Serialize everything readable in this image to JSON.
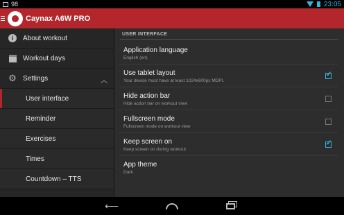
{
  "status_bar": {
    "notification_text": "98",
    "time": "23:05"
  },
  "action_bar": {
    "title": "Caynax A6W PRO"
  },
  "drawer": {
    "items": [
      {
        "label": "About workout",
        "icon": "info-icon"
      },
      {
        "label": "Workout days",
        "icon": "calendar-icon"
      },
      {
        "label": "Settings",
        "icon": "gear-icon",
        "expanded": true
      }
    ],
    "subitems": [
      {
        "label": "User interface",
        "active": true
      },
      {
        "label": "Reminder"
      },
      {
        "label": "Exercises"
      },
      {
        "label": "Times"
      },
      {
        "label": "Countdown – TTS"
      }
    ]
  },
  "content": {
    "section_title": "USER INTERFACE",
    "preferences": [
      {
        "title": "Application language",
        "summary": "English (en)",
        "checkbox": null
      },
      {
        "title": "Use tablet layout",
        "summary": "Your device must have at least 1024x600px MDPI.",
        "checkbox": true
      },
      {
        "title": "Hide action bar",
        "summary": "Hide action bar on workout view",
        "checkbox": false
      },
      {
        "title": "Fullscreen mode",
        "summary": "Fullscreen mode on workout view",
        "checkbox": false
      },
      {
        "title": "Keep screen on",
        "summary": "Keep screen on during workout",
        "checkbox": true
      },
      {
        "title": "App theme",
        "summary": "Dark",
        "checkbox": null
      }
    ]
  },
  "colors": {
    "accent": "#b3262c",
    "check": "#33b5e5"
  }
}
